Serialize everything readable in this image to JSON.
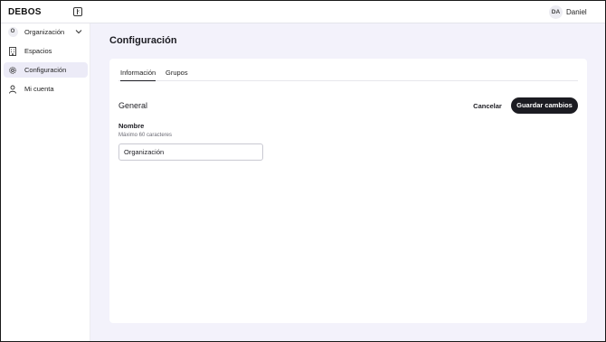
{
  "app": {
    "logo": "DEBOS",
    "user_initials": "DA",
    "user_name": "Daniel"
  },
  "sidebar": {
    "org": {
      "initial": "O",
      "label": "Organización"
    },
    "items": [
      {
        "label": "Espacios",
        "icon": "building-icon"
      },
      {
        "label": "Configuración",
        "icon": "gear-icon",
        "active": true
      },
      {
        "label": "Mi cuenta",
        "icon": "user-icon"
      }
    ]
  },
  "main": {
    "title": "Configuración",
    "tabs": [
      {
        "label": "Información",
        "active": true
      },
      {
        "label": "Grupos",
        "active": false
      }
    ],
    "section_title": "General",
    "cancel_label": "Cancelar",
    "save_label": "Guardar cambios",
    "field": {
      "label": "Nombre",
      "hint": "Máximo 60 caracteres",
      "value": "Organización"
    }
  },
  "colors": {
    "accent": "#1c1c22",
    "main_bg": "#f3f2fb",
    "active_nav_bg": "#ecebf7"
  }
}
